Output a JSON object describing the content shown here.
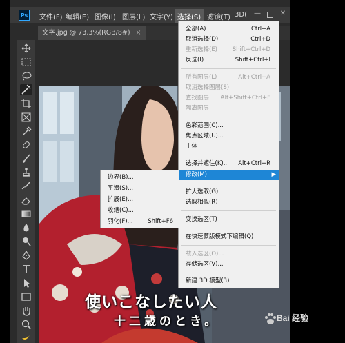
{
  "app": {
    "logo": "Ps"
  },
  "menubar": {
    "items": [
      "文件(F)",
      "编辑(E)",
      "图像(I)",
      "图层(L)",
      "文字(Y)",
      "选择(S)",
      "滤镜(T)",
      "3D("
    ],
    "active": "选择(S)"
  },
  "document": {
    "tab_title": "文字.jpg @ 73.3%(RGB/8#)",
    "close": "×"
  },
  "select_menu": {
    "items": [
      {
        "label": "全部(A)",
        "shortcut": "Ctrl+A",
        "enabled": true
      },
      {
        "label": "取消选择(D)",
        "shortcut": "Ctrl+D",
        "enabled": true
      },
      {
        "label": "重新选择(E)",
        "shortcut": "Shift+Ctrl+D",
        "enabled": false
      },
      {
        "label": "反选(I)",
        "shortcut": "Shift+Ctrl+I",
        "enabled": true
      },
      {
        "label": "所有图层(L)",
        "shortcut": "Alt+Ctrl+A",
        "enabled": false
      },
      {
        "label": "取消选择图层(S)",
        "shortcut": "",
        "enabled": false
      },
      {
        "label": "查找图层",
        "shortcut": "Alt+Shift+Ctrl+F",
        "enabled": false
      },
      {
        "label": "隔离图层",
        "shortcut": "",
        "enabled": false
      },
      {
        "label": "色彩范围(C)...",
        "shortcut": "",
        "enabled": true
      },
      {
        "label": "焦点区域(U)...",
        "shortcut": "",
        "enabled": true
      },
      {
        "label": "主体",
        "shortcut": "",
        "enabled": true
      },
      {
        "label": "选择并遮住(K)...",
        "shortcut": "Alt+Ctrl+R",
        "enabled": true
      },
      {
        "label": "修改(M)",
        "shortcut": "",
        "enabled": true,
        "highlighted": true,
        "submenu": true
      },
      {
        "label": "扩大选取(G)",
        "shortcut": "",
        "enabled": true
      },
      {
        "label": "选取相似(R)",
        "shortcut": "",
        "enabled": true
      },
      {
        "label": "变换选区(T)",
        "shortcut": "",
        "enabled": true
      },
      {
        "label": "在快速蒙版模式下编辑(Q)",
        "shortcut": "",
        "enabled": true
      },
      {
        "label": "载入选区(O)...",
        "shortcut": "",
        "enabled": false
      },
      {
        "label": "存储选区(V)...",
        "shortcut": "",
        "enabled": true
      },
      {
        "label": "新建 3D 模型(3)",
        "shortcut": "",
        "enabled": true
      }
    ]
  },
  "modify_submenu": {
    "items": [
      {
        "label": "边界(B)...",
        "shortcut": ""
      },
      {
        "label": "平滑(S)...",
        "shortcut": ""
      },
      {
        "label": "扩展(E)...",
        "shortcut": ""
      },
      {
        "label": "收缩(C)...",
        "shortcut": ""
      },
      {
        "label": "羽化(F)...",
        "shortcut": "Shift+F6"
      }
    ]
  },
  "image_caption": {
    "line1": "使いこなしたい人",
    "line2": "十二歳のとき。"
  },
  "watermark": {
    "text": "Bai 经验"
  },
  "toolbar": {
    "tools": [
      "move-tool-icon",
      "marquee-tool-icon",
      "lasso-tool-icon",
      "magic-wand-tool-icon",
      "crop-tool-icon",
      "frame-tool-icon",
      "eyedropper-tool-icon",
      "healing-brush-tool-icon",
      "brush-tool-icon",
      "clone-stamp-tool-icon",
      "history-brush-tool-icon",
      "eraser-tool-icon",
      "gradient-tool-icon",
      "blur-tool-icon",
      "dodge-tool-icon",
      "pen-tool-icon",
      "type-tool-icon",
      "path-selection-tool-icon",
      "rectangle-tool-icon",
      "hand-tool-icon",
      "zoom-tool-icon",
      "banana-icon"
    ],
    "selected": "magic-wand-tool-icon"
  },
  "colors": {
    "menu_highlight": "#1e86d6",
    "menubar": "#3a3a3a",
    "canvas_bg": "#2b2b2b"
  }
}
